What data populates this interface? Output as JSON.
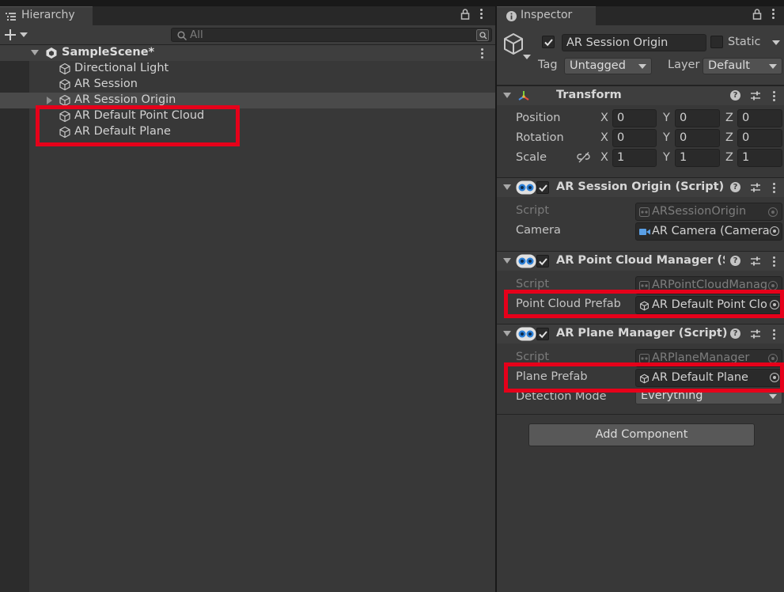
{
  "hierarchy": {
    "tab_title": "Hierarchy",
    "search_placeholder": "All",
    "scene_name": "SampleScene*",
    "items": [
      {
        "label": "Directional Light"
      },
      {
        "label": "AR Session"
      },
      {
        "label": "AR Session Origin",
        "collapsed": true
      },
      {
        "label": "AR Default Point Cloud"
      },
      {
        "label": "AR Default Plane"
      }
    ]
  },
  "inspector": {
    "tab_title": "Inspector",
    "object_name": "AR Session Origin",
    "active": true,
    "static_label": "Static",
    "tag_label": "Tag",
    "tag_value": "Untagged",
    "layer_label": "Layer",
    "layer_value": "Default",
    "transform": {
      "title": "Transform",
      "position_label": "Position",
      "rotation_label": "Rotation",
      "scale_label": "Scale",
      "axis": [
        "X",
        "Y",
        "Z"
      ],
      "position": [
        "0",
        "0",
        "0"
      ],
      "rotation": [
        "0",
        "0",
        "0"
      ],
      "scale": [
        "1",
        "1",
        "1"
      ]
    },
    "session_origin": {
      "title": "AR Session Origin (Script)",
      "script_label": "Script",
      "script_value": "ARSessionOrigin",
      "camera_label": "Camera",
      "camera_value": "AR Camera (Camera"
    },
    "point_cloud_manager": {
      "title": "AR Point Cloud Manager (Scr",
      "script_label": "Script",
      "script_value": "ARPointCloudManag",
      "prefab_label": "Point Cloud Prefab",
      "prefab_value": "AR Default Point Clo"
    },
    "plane_manager": {
      "title": "AR Plane Manager (Script)",
      "script_label": "Script",
      "script_value": "ARPlaneManager",
      "prefab_label": "Plane Prefab",
      "prefab_value": "AR Default Plane",
      "detection_label": "Detection Mode",
      "detection_value": "Everything"
    },
    "add_component_label": "Add Component"
  },
  "colors": {
    "highlight": "#e6001a",
    "panel_bg": "#383838",
    "header_bg": "#3c3c3c"
  }
}
